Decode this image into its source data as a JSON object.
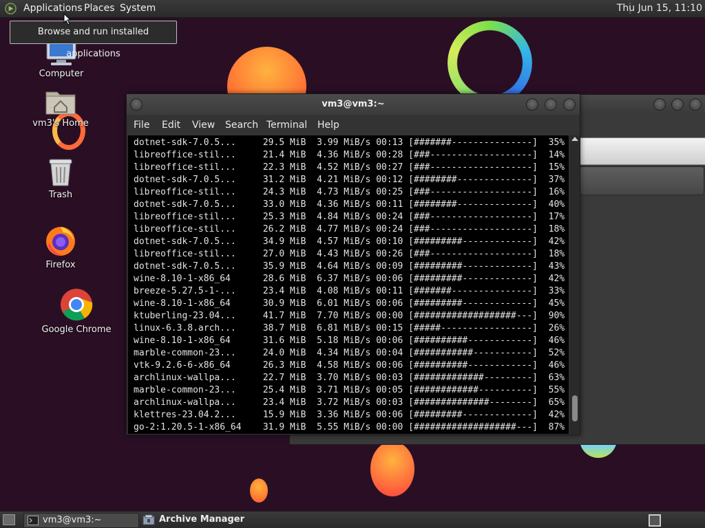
{
  "top_panel": {
    "menus": [
      "Applications",
      "Places",
      "System"
    ],
    "clock": "Thu Jun 15, 11:10"
  },
  "tooltip": "Browse and run installed applications",
  "desktop_icons": [
    {
      "label": "Computer",
      "icon": "computer-icon"
    },
    {
      "label": "vm3's Home",
      "icon": "home-folder-icon"
    },
    {
      "label": "Trash",
      "icon": "trash-icon"
    },
    {
      "label": "Firefox",
      "icon": "firefox-icon"
    },
    {
      "label": "Google Chrome",
      "icon": "chrome-icon"
    }
  ],
  "terminal": {
    "title": "vm3@vm3:~",
    "menu": [
      "File",
      "Edit",
      "View",
      "Search",
      "Terminal",
      "Help"
    ],
    "lines": [
      "dotnet-sdk-7.0.5...     29.5 MiB  3.99 MiB/s 00:13 [#######---------------]  35%",
      "libreoffice-stil...     21.4 MiB  4.36 MiB/s 00:28 [###-------------------]  14%",
      "libreoffice-stil...     22.3 MiB  4.52 MiB/s 00:27 [###-------------------]  15%",
      "dotnet-sdk-7.0.5...     31.2 MiB  4.21 MiB/s 00:12 [########--------------]  37%",
      "libreoffice-stil...     24.3 MiB  4.73 MiB/s 00:25 [###-------------------]  16%",
      "dotnet-sdk-7.0.5...     33.0 MiB  4.36 MiB/s 00:11 [########--------------]  40%",
      "libreoffice-stil...     25.3 MiB  4.84 MiB/s 00:24 [###-------------------]  17%",
      "libreoffice-stil...     26.2 MiB  4.77 MiB/s 00:24 [###-------------------]  18%",
      "dotnet-sdk-7.0.5...     34.9 MiB  4.57 MiB/s 00:10 [#########-------------]  42%",
      "libreoffice-stil...     27.0 MiB  4.43 MiB/s 00:26 [###-------------------]  18%",
      "dotnet-sdk-7.0.5...     35.9 MiB  4.64 MiB/s 00:09 [#########-------------]  43%",
      "wine-8.10-1-x86_64      28.6 MiB  6.37 MiB/s 00:06 [#########-------------]  42%",
      "breeze-5.27.5-1-...     23.4 MiB  4.08 MiB/s 00:11 [#######---------------]  33%",
      "wine-8.10-1-x86_64      30.9 MiB  6.01 MiB/s 00:06 [#########-------------]  45%",
      "ktuberling-23.04...     41.7 MiB  7.70 MiB/s 00:00 [###################---]  90%",
      "linux-6.3.8.arch...     38.7 MiB  6.81 MiB/s 00:15 [#####-----------------]  26%",
      "wine-8.10-1-x86_64      31.6 MiB  5.18 MiB/s 00:06 [##########------------]  46%",
      "marble-common-23...     24.0 MiB  4.34 MiB/s 00:04 [###########-----------]  52%",
      "vtk-9.2.6-6-x86_64      26.3 MiB  4.58 MiB/s 00:06 [##########------------]  46%",
      "archlinux-wallpa...     22.7 MiB  3.70 MiB/s 00:03 [#############---------]  63%",
      "marble-common-23...     25.4 MiB  3.71 MiB/s 00:05 [############----------]  55%",
      "archlinux-wallpa...     23.4 MiB  3.72 MiB/s 00:03 [##############--------]  65%",
      "klettres-23.04.2...     15.9 MiB  3.36 MiB/s 00:06 [#########-------------]  42%",
      "go-2:1.20.5-1-x86_64    31.9 MiB  5.55 MiB/s 00:00 [###################---]  87%"
    ]
  },
  "taskbar": {
    "items": [
      {
        "label": "vm3@vm3:~",
        "icon": "terminal-icon"
      },
      {
        "label": "Archive Manager",
        "icon": "archive-manager-icon"
      }
    ]
  }
}
